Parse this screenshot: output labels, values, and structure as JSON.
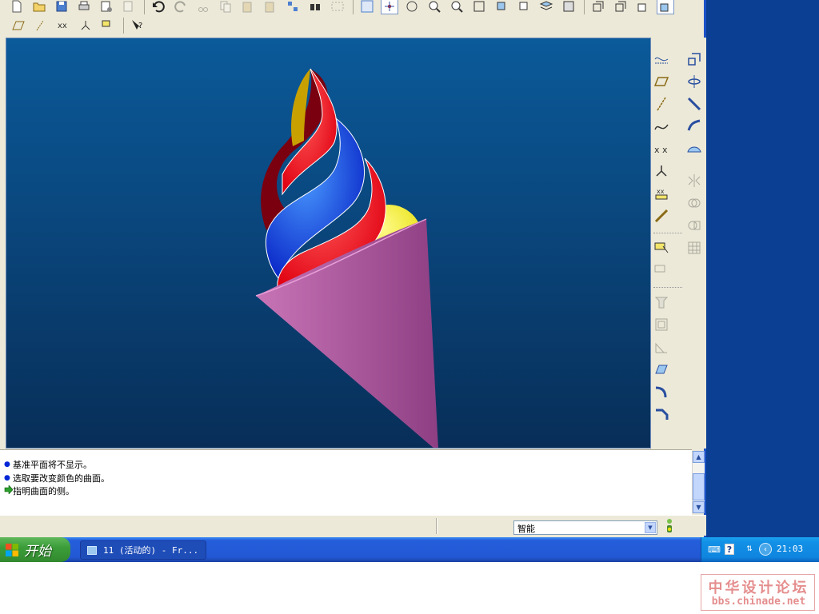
{
  "window": {
    "title": "11 (活动的) - Fr..."
  },
  "top_toolbar": {
    "row1_icons": [
      "new-file-icon",
      "open-file-icon",
      "save-icon",
      "print-icon",
      "send-icon",
      "email-icon",
      "undo-icon",
      "redo-icon",
      "cut-icon",
      "copy-icon",
      "paste-icon",
      "paste-special-icon",
      "regenerate-icon",
      "find-icon",
      "select-box-icon",
      "redraw-icon",
      "spin-center-icon",
      "orient-icon",
      "zoom-in-icon",
      "zoom-out-icon",
      "refit-icon",
      "reorient-icon",
      "saved-views-icon",
      "layers-icon",
      "view-manager-icon",
      "wireframe-icon",
      "hidden-line-icon",
      "no-hidden-icon",
      "shading-icon"
    ],
    "row2_icons": [
      "datum-plane-display-icon",
      "datum-axis-display-icon",
      "point-display-icon",
      "csys-display-icon",
      "annotation-display-icon",
      "context-help-icon"
    ]
  },
  "right_toolbar": {
    "left_column": [
      "sketch-icon",
      "datum-plane-icon",
      "datum-axis-icon",
      "datum-curve-icon",
      "datum-point-icon",
      "csys-icon",
      "analysis-icon",
      "annotation-icon",
      "sketch-tool-icon",
      "insert-icon",
      "hole-icon",
      "shell-icon",
      "rib-icon",
      "draft-icon",
      "round-icon",
      "chamfer-icon"
    ],
    "right_column": [
      "extrude-icon",
      "revolve-icon",
      "variable-sweep-icon",
      "boundary-blend-icon",
      "style-icon",
      "mirror-icon",
      "merge-icon",
      "trim-icon",
      "pattern-icon"
    ]
  },
  "messages": [
    {
      "type": "info",
      "text": "基准平面将不显示。"
    },
    {
      "type": "info",
      "text": "选取要改变颜色的曲面。"
    },
    {
      "type": "prompt",
      "text": "指明曲面的侧。"
    }
  ],
  "status": {
    "filter_value": "智能"
  },
  "taskbar": {
    "start_label": "开始",
    "task_label": "11 (活动的) - Fr...",
    "clock": "21:03"
  },
  "watermark": {
    "title": "中华设计论坛",
    "url": "bbs.chinade.net"
  },
  "colors": {
    "viewport_top": "#0b5a9a",
    "viewport_bottom": "#082e58",
    "cone": "#c875b7",
    "swirl_red": "#e00010",
    "swirl_blue": "#0a28c8",
    "swirl_darkred": "#7a0010",
    "swirl_yellow": "#e8e010"
  }
}
